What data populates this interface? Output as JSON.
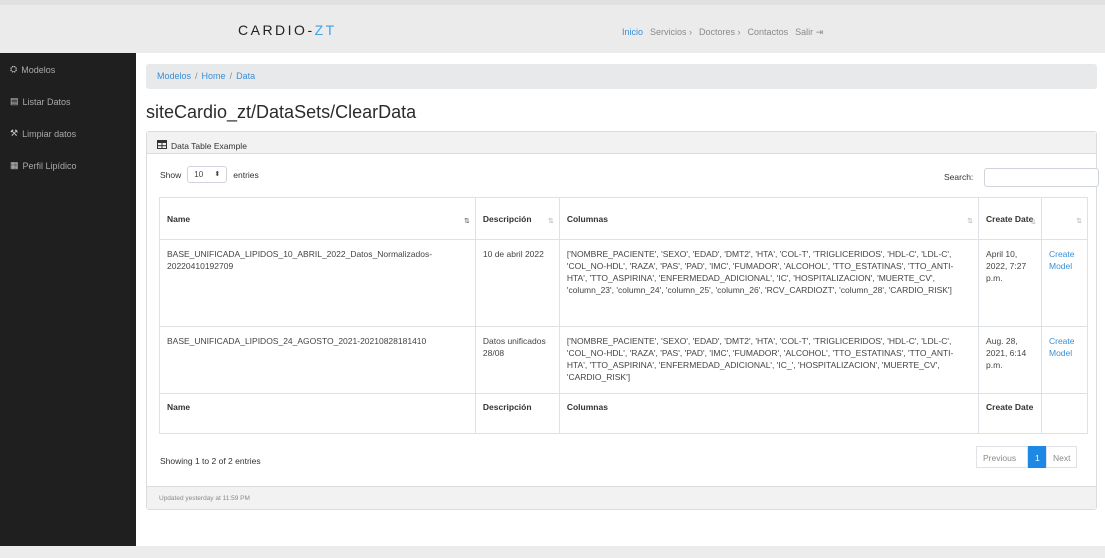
{
  "topbar": {
    "brand_main": "CARDIO-",
    "brand_accent": "ZT",
    "nav": [
      "Inicio",
      "Servicios ›",
      "Doctores ›",
      "Contactos",
      "Salir ⇥"
    ]
  },
  "sidebar": {
    "items": [
      {
        "icon": "⛭",
        "label": "Modelos"
      },
      {
        "icon": "▤",
        "label": "Listar Datos"
      },
      {
        "icon": "⚒",
        "label": "Limpiar datos"
      },
      {
        "icon": "▦",
        "label": "Perfil Lipídico"
      }
    ]
  },
  "breadcrumb": {
    "items": [
      "Modelos",
      "Home",
      "Data"
    ]
  },
  "page": {
    "title": "siteCardio_zt/DataSets/ClearData"
  },
  "card": {
    "header": "Data Table Example",
    "footer": "Updated yesterday at 11:59 PM"
  },
  "table_controls": {
    "show_label": "Show",
    "entries_value": "10",
    "entries_label": "entries",
    "search_label": "Search:",
    "search_value": ""
  },
  "table": {
    "headers": [
      "Name",
      "Descripción",
      "Columnas",
      "Create Date",
      ""
    ],
    "footers": [
      "Name",
      "Descripción",
      "Columnas",
      "Create Date",
      ""
    ],
    "rows": [
      {
        "name": "BASE_UNIFICADA_LIPIDOS_10_ABRIL_2022_Datos_Normalizados-20220410192709",
        "descripcion": "10 de abril 2022",
        "columnas": "['NOMBRE_PACIENTE', 'SEXO', 'EDAD', 'DMT2', 'HTA', 'COL-T', 'TRIGLICERIDOS', 'HDL-C', 'LDL-C', 'COL_NO-HDL', 'RAZA', 'PAS', 'PAD', 'IMC', 'FUMADOR', 'ALCOHOL', 'TTO_ESTATINAS', 'TTO_ANTI-HTA', 'TTO_ASPIRINA', 'ENFERMEDAD_ADICIONAL', 'IC', 'HOSPITALIZACION', 'MUERTE_CV', 'column_23', 'column_24', 'column_25', 'column_26', 'RCV_CARDIOZT', 'column_28', 'CARDIO_RISK']",
        "date": "April 10, 2022, 7:27 p.m.",
        "action": "Create Model"
      },
      {
        "name": "BASE_UNIFICADA_LIPIDOS_24_AGOSTO_2021-20210828181410",
        "descripcion": "Datos unificados 28/08",
        "columnas": "['NOMBRE_PACIENTE', 'SEXO', 'EDAD', 'DMT2', 'HTA', 'COL-T', 'TRIGLICERIDOS', 'HDL-C', 'LDL-C', 'COL_NO-HDL', 'RAZA', 'PAS', 'PAD', 'IMC', 'FUMADOR', 'ALCOHOL', 'TTO_ESTATINAS', 'TTO_ANTI-HTA', 'TTO_ASPIRINA', 'ENFERMEDAD_ADICIONAL', 'IC_', 'HOSPITALIZACION', 'MUERTE_CV', 'CARDIO_RISK']",
        "date": "Aug. 28, 2021, 6:14 p.m.",
        "action": "Create Model"
      }
    ]
  },
  "table_info": "Showing 1 to 2 of 2 entries",
  "pagination": {
    "previous": "Previous",
    "current": "1",
    "next": "Next"
  }
}
